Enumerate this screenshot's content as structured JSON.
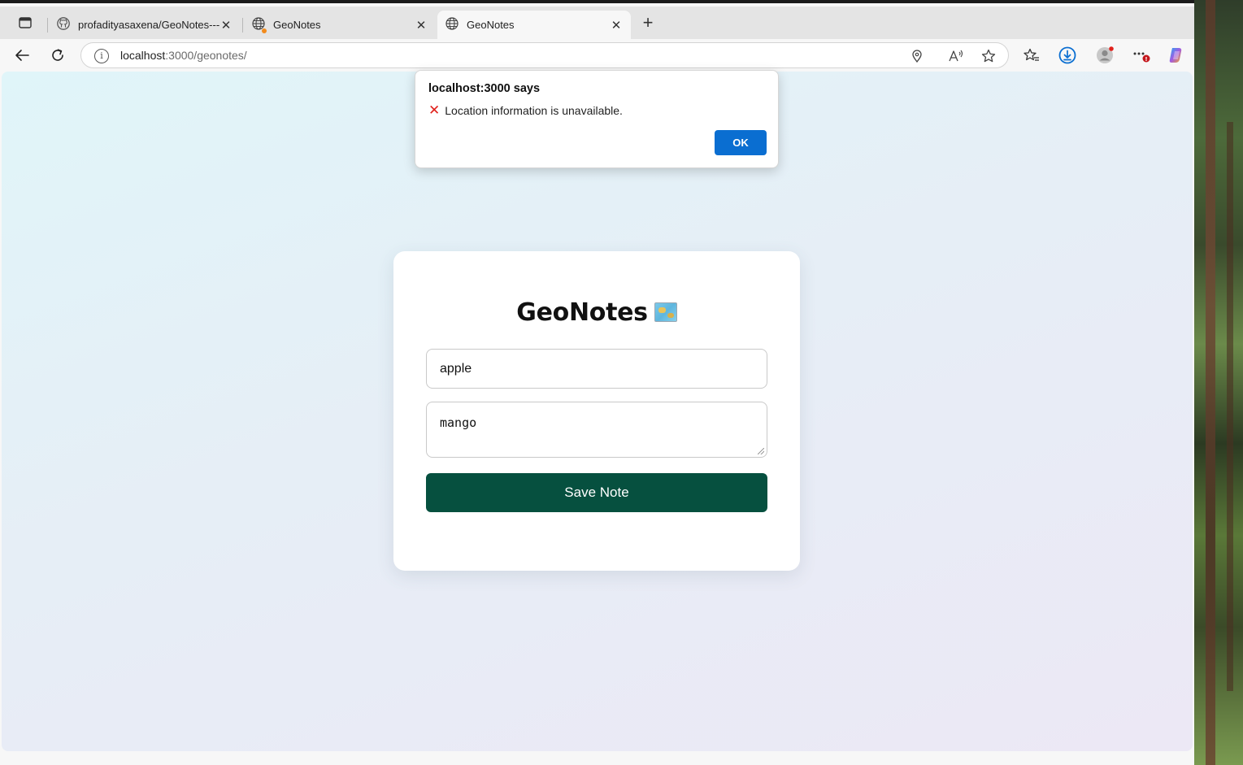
{
  "tabs": [
    {
      "title": "profadityasaxena/GeoNotes---I",
      "favicon": "github-icon",
      "active": false
    },
    {
      "title": "GeoNotes",
      "favicon": "globe-icon",
      "active": false
    },
    {
      "title": "GeoNotes",
      "favicon": "globe-icon",
      "active": true
    }
  ],
  "omnibox": {
    "host": "localhost",
    "path": ":3000/geonotes/"
  },
  "app": {
    "title": "GeoNotes",
    "note_title_value": "apple",
    "note_content_value": "mango",
    "save_label": "Save Note"
  },
  "alert": {
    "title": "localhost:3000 says",
    "message": "Location information is unavailable.",
    "ok_label": "OK"
  },
  "colors": {
    "save_button": "#06503f",
    "ok_button": "#0a6ed1",
    "error_x": "#e0201b"
  }
}
